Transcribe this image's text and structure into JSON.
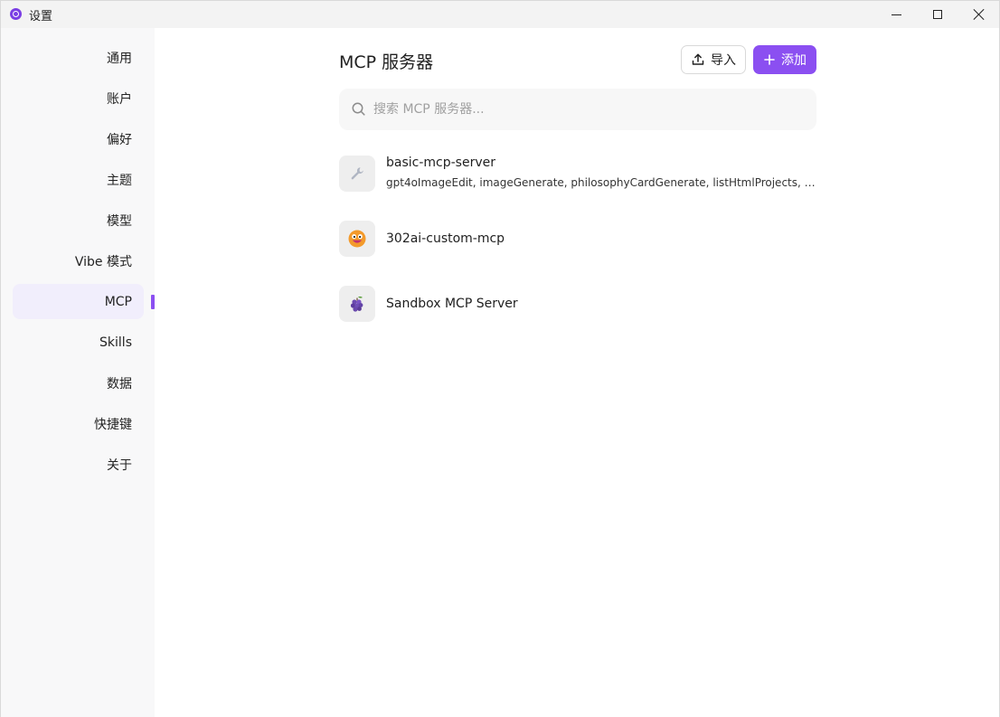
{
  "window": {
    "title": "设置"
  },
  "sidebar": {
    "items": [
      {
        "label": "通用"
      },
      {
        "label": "账户"
      },
      {
        "label": "偏好"
      },
      {
        "label": "主题"
      },
      {
        "label": "模型"
      },
      {
        "label": "Vibe 模式"
      },
      {
        "label": "MCP",
        "active": true
      },
      {
        "label": "Skills"
      },
      {
        "label": "数据"
      },
      {
        "label": "快捷键"
      },
      {
        "label": "关于"
      }
    ]
  },
  "main": {
    "title": "MCP 服务器",
    "import_label": "导入",
    "add_label": "添加",
    "search": {
      "placeholder": "搜索 MCP 服务器..."
    },
    "servers": [
      {
        "name": "basic-mcp-server",
        "icon": "wrench-icon",
        "tools": "gpt4oImageEdit, imageGenerate, philosophyCardGenerate, listHtmlProjects, knowledgeBaseSearch"
      },
      {
        "name": "302ai-custom-mcp",
        "icon": "smiley-face-icon",
        "tools": ""
      },
      {
        "name": "Sandbox MCP Server",
        "icon": "grapes-icon",
        "tools": ""
      }
    ]
  },
  "colors": {
    "accent": "#8b4ff1",
    "active_nav_bg": "#f1eefc",
    "sidebar_bg": "#f8f8f9"
  }
}
